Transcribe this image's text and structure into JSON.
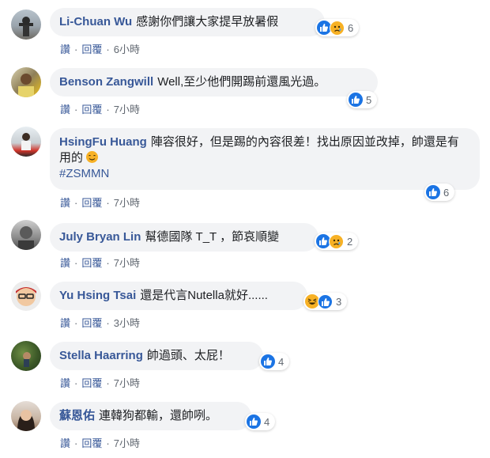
{
  "comments": [
    {
      "author": "Li-Chuan Wu",
      "text": "感謝你們讓大家提早放暑假",
      "reaction_count": "6",
      "reactions": [
        "like",
        "sad"
      ],
      "time": "6小時"
    },
    {
      "author": "Benson Zangwill",
      "text": "Well,至少他們開踢前還風光過。",
      "reaction_count": "5",
      "reactions": [
        "like"
      ],
      "time": "7小時"
    },
    {
      "author": "HsingFu Huang",
      "text": "陣容很好，但是踢的內容很差！找出原因並改掉，帥還是有用的",
      "hashtag": "#ZSMMN",
      "reaction_count": "6",
      "reactions": [
        "like"
      ],
      "time": "7小時"
    },
    {
      "author": "July Bryan Lin",
      "text": "幫德國隊 T_T ，節哀順變",
      "reaction_count": "2",
      "reactions": [
        "like",
        "sad"
      ],
      "time": "7小時"
    },
    {
      "author": "Yu Hsing Tsai",
      "text": "還是代言Nutella就好......",
      "reaction_count": "3",
      "reactions": [
        "haha",
        "like"
      ],
      "time": "3小時"
    },
    {
      "author": "Stella Haarring",
      "text": "帥過頭、太屁！",
      "reaction_count": "4",
      "reactions": [
        "like"
      ],
      "time": "7小時"
    },
    {
      "author": "蘇恩佑",
      "text": "連韓狗都輸，還帥咧。",
      "reaction_count": "4",
      "reactions": [
        "like"
      ],
      "time": "7小時"
    }
  ],
  "labels": {
    "like": "讚",
    "reply": "回覆"
  },
  "colors": {
    "link": "#385898",
    "bubble": "#f2f3f5",
    "like_blue": "#1b74e4",
    "emoji_yellow": "#f7b125"
  }
}
